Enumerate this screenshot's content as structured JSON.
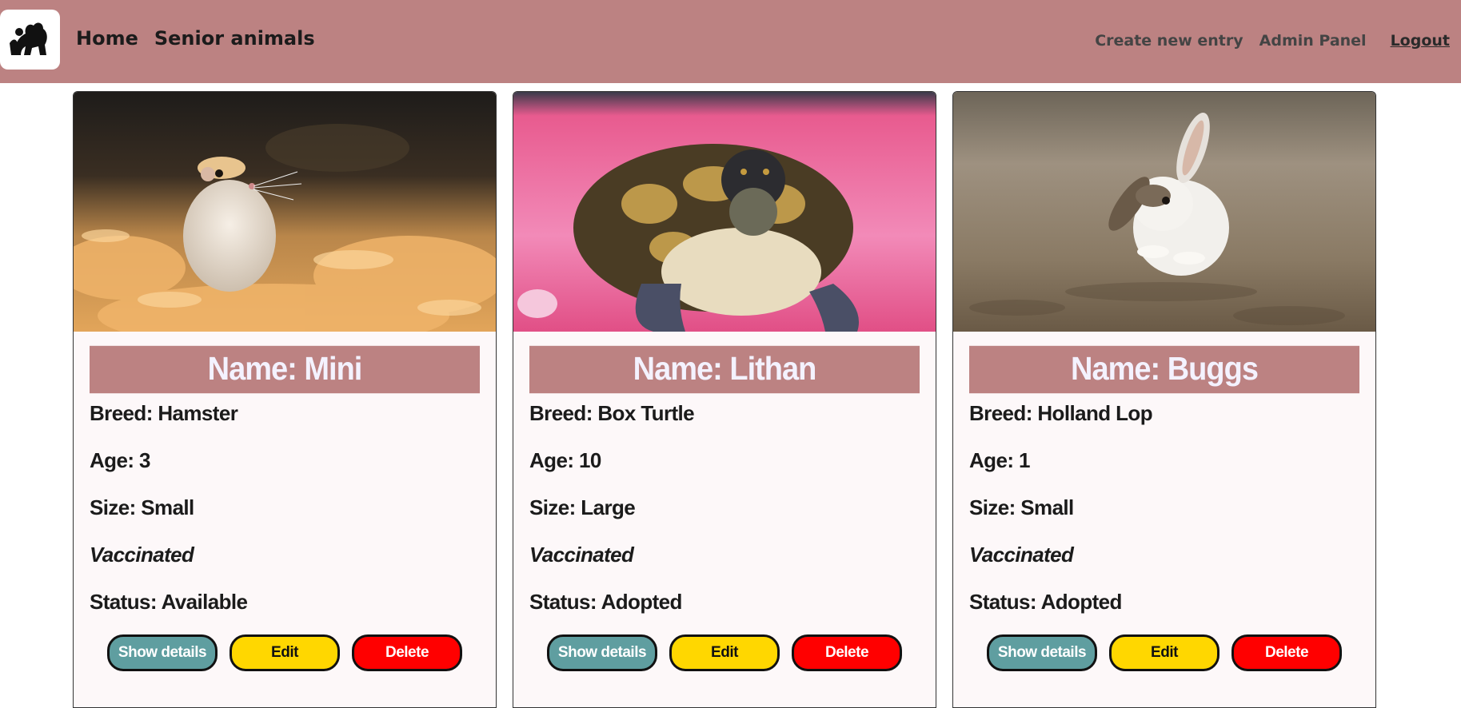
{
  "nav": {
    "home": "Home",
    "senior": "Senior animals",
    "create": "Create new entry",
    "admin": "Admin Panel",
    "logout": "Logout"
  },
  "labels": {
    "vaccinated": "Vaccinated",
    "show_details": "Show details",
    "edit": "Edit",
    "delete": "Delete"
  },
  "cards": [
    {
      "name": "Name: Mini",
      "breed": "Breed: Hamster",
      "age": "Age: 3",
      "size": "Size: Small",
      "status": "Status: Available",
      "photo": "hamster-photo"
    },
    {
      "name": "Name: Lithan",
      "breed": "Breed: Box Turtle",
      "age": "Age: 10",
      "size": "Size: Large",
      "status": "Status: Adopted",
      "photo": "turtle-photo"
    },
    {
      "name": "Name: Buggs",
      "breed": "Breed: Holland Lop",
      "age": "Age: 1",
      "size": "Size: Small",
      "status": "Status: Adopted",
      "photo": "rabbit-photo"
    }
  ],
  "colors": {
    "navbar": "#bc8282",
    "details_button": "#5f9ea0",
    "edit_button": "#ffd700",
    "delete_button": "#ff0000"
  }
}
